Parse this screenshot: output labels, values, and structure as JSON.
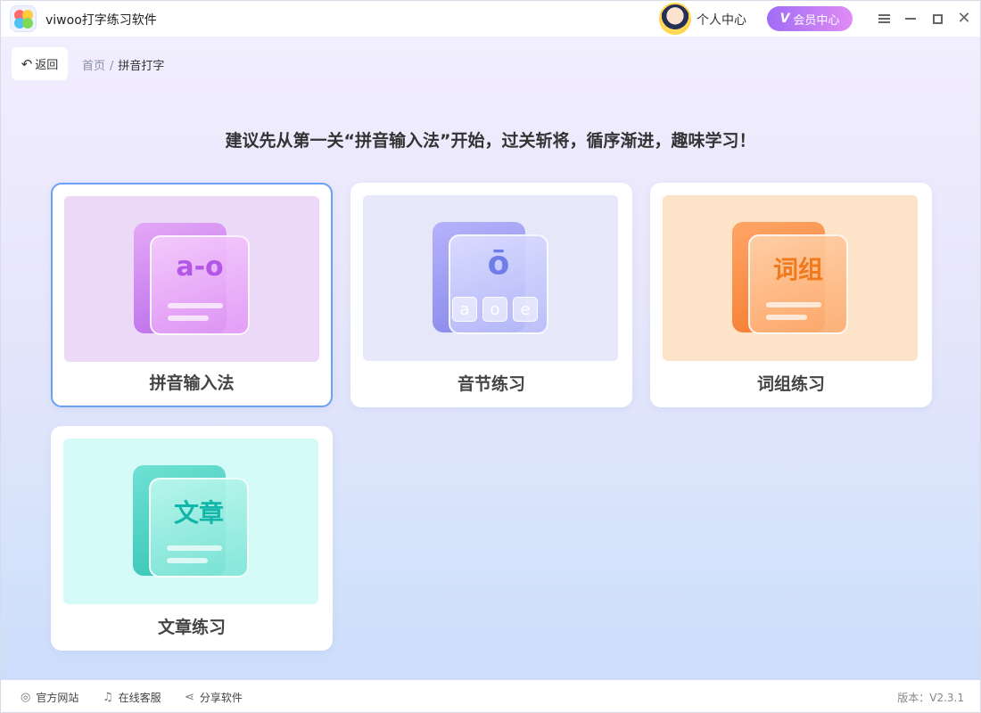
{
  "window": {
    "title": "viwoo打字练习软件"
  },
  "header": {
    "personal_center": "个人中心",
    "vip_label": "会员中心",
    "vip_badge": "V"
  },
  "nav": {
    "back_label": "返回",
    "breadcrumb": {
      "home": "首页",
      "sep": "/",
      "current": "拼音打字"
    }
  },
  "headline": "建议先从第一关“拼音输入法”开始，过关斩将，循序渐进，趣味学习！",
  "cards": [
    {
      "label": "拼音输入法",
      "glyph": "a-o"
    },
    {
      "label": "音节练习",
      "glyph": "ō",
      "keys": [
        "a",
        "o",
        "e"
      ]
    },
    {
      "label": "词组练习",
      "glyph": "词组"
    },
    {
      "label": "文章练习",
      "glyph": "文章"
    }
  ],
  "footer": {
    "website": "官方网站",
    "service": "在线客服",
    "share": "分享软件",
    "version": "版本：V2.3.1"
  },
  "colors": {
    "accent": "#6aa1f3",
    "vip_start": "#a06cf5",
    "vip_end": "#e08cf5"
  }
}
